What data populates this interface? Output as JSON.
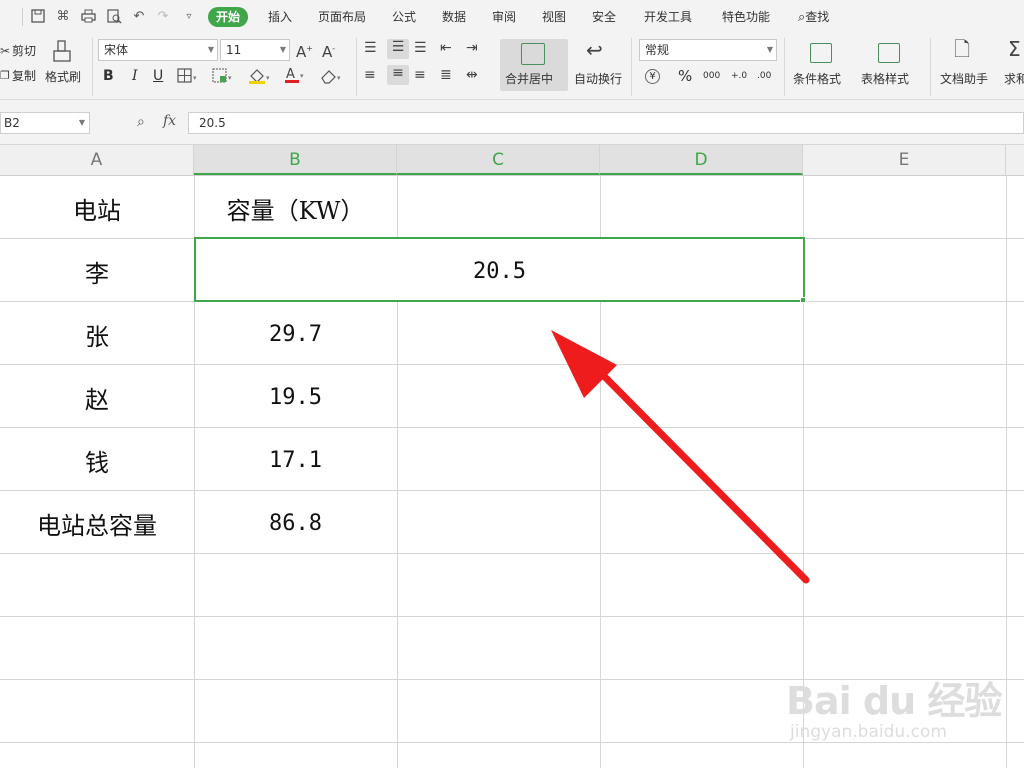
{
  "quick_access": {
    "icons": [
      "save-icon",
      "brush-icon",
      "print-icon",
      "print-preview-icon",
      "undo-icon",
      "redo-icon",
      "more-icon"
    ]
  },
  "menu": {
    "tabs": [
      "开始",
      "插入",
      "页面布局",
      "公式",
      "数据",
      "审阅",
      "视图",
      "安全",
      "开发工具",
      "特色功能"
    ],
    "active_tab": "开始",
    "search_label": "查找"
  },
  "toolbar": {
    "cut_label": "剪切",
    "copy_label": "复制",
    "format_painter_label": "格式刷",
    "font_name": "宋体",
    "font_size": "11",
    "bold": "B",
    "italic": "I",
    "underline": "U",
    "merge_center_label": "合并居中",
    "wrap_text_label": "自动换行",
    "number_format": "常规",
    "currency_symbol": "¥",
    "percent_symbol": "%",
    "thousands_symbol": "000",
    "increase_decimal": "+.0",
    "decrease_decimal": ".00",
    "conditional_format_label": "条件格式",
    "table_style_label": "表格样式",
    "doc_assistant_label": "文档助手",
    "sum_label": "求和"
  },
  "formula_bar": {
    "name_box": "B2",
    "fx": "fx",
    "formula": "20.5"
  },
  "sheet": {
    "columns": [
      "A",
      "B",
      "C",
      "D",
      "E"
    ],
    "selected_columns": [
      "B",
      "C",
      "D"
    ],
    "rows": [
      {
        "a": "电站",
        "b": "容量（KW）"
      },
      {
        "a": "李",
        "b": "20.5"
      },
      {
        "a": "张",
        "b": "29.7"
      },
      {
        "a": "赵",
        "b": "19.5"
      },
      {
        "a": "钱",
        "b": "17.1"
      },
      {
        "a": "电站总容量",
        "b": "86.8"
      }
    ],
    "merged_range": "B2:D2"
  },
  "annotation": {
    "arrow_color": "#ee1c1c"
  },
  "watermark": {
    "brand": "Bai du 经验",
    "url": "jingyan.baidu.com"
  },
  "colors": {
    "accent_green": "#3fa64a",
    "ribbon_bg": "#f3f3f3"
  }
}
